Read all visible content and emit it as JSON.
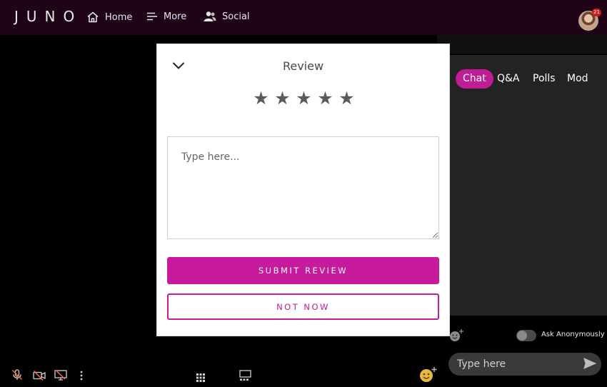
{
  "header": {
    "logo": "JUNO",
    "nav": [
      {
        "label": "Home",
        "icon": "home-icon"
      },
      {
        "label": "More",
        "icon": "menu-icon"
      },
      {
        "label": "Social",
        "icon": "people-icon"
      }
    ],
    "notification_count": "21"
  },
  "chat": {
    "tabs": [
      {
        "label": "Chat",
        "active": true
      },
      {
        "label": "Q&A",
        "active": false
      },
      {
        "label": "Polls",
        "active": false
      },
      {
        "label": "Mod",
        "active": false
      }
    ],
    "ask_anonymously_label": "Ask Anonymously",
    "ask_anonymously_on": false,
    "input_placeholder": "Type here"
  },
  "toolbar": {
    "icons": [
      "mic-off-icon",
      "camera-off-icon",
      "screen-share-off-icon",
      "more-vertical-icon",
      "grid-icon",
      "layout-icon",
      "emoji-icon"
    ]
  },
  "review_modal": {
    "title": "Review",
    "rating": 0,
    "max_rating": 5,
    "textarea_placeholder": "Type here...",
    "textarea_value": "",
    "submit_label": "SUBMIT REVIEW",
    "dismiss_label": "NOT NOW"
  },
  "colors": {
    "accent": "#c51b9c",
    "topbar_bg": "#1f0418",
    "chat_bg": "#232323"
  }
}
